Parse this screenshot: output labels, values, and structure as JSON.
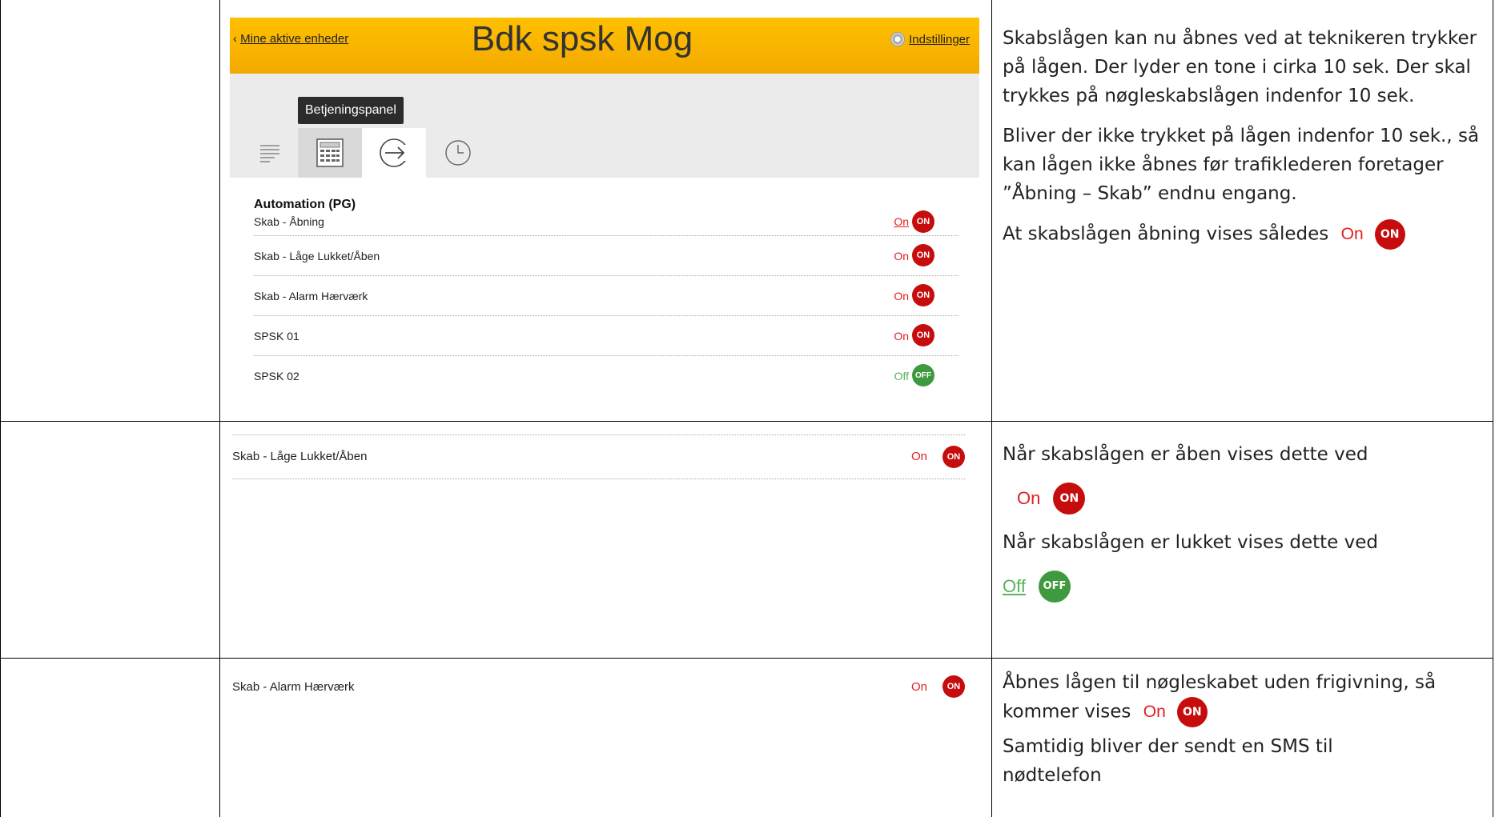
{
  "app": {
    "back_link": "Mine aktive enheder",
    "title": "Bdk spsk Mog",
    "settings_label": "Indstillinger",
    "tooltip": "Betjeningspanel",
    "tabs": [
      {
        "icon": "list-icon",
        "selected": false
      },
      {
        "icon": "keypad-icon",
        "selected": false
      },
      {
        "icon": "arrow-right-circle-icon",
        "selected": true
      },
      {
        "icon": "clock-icon",
        "selected": false
      }
    ],
    "section_title": "Automation (PG)",
    "rows": [
      {
        "label": "Skab - Åbning",
        "state": "On",
        "badge": "ON",
        "status": "on"
      },
      {
        "label": "Skab - Låge Lukket/Åben",
        "state": "On",
        "badge": "ON",
        "status": "on"
      },
      {
        "label": "Skab - Alarm Hærværk",
        "state": "On",
        "badge": "ON",
        "status": "on"
      },
      {
        "label": "SPSK 01",
        "state": "On",
        "badge": "ON",
        "status": "on"
      },
      {
        "label": "SPSK 02",
        "state": "Off",
        "badge": "OFF",
        "status": "off"
      }
    ]
  },
  "row2": {
    "label": "Skab - Låge Lukket/Åben",
    "state": "On",
    "badge": "ON"
  },
  "row3": {
    "label": "Skab - Alarm Hærværk",
    "state": "On",
    "badge": "ON"
  },
  "desc1": {
    "p1": "Skabslågen kan nu åbnes ved at teknikeren trykker på lågen. Der lyder en tone i cirka 10 sek. Der skal trykkes på nøgleskabslågen indenfor 10 sek.",
    "p2": "Bliver der ikke trykket på lågen indenfor 10 sek., så kan lågen ikke åbnes før trafiklederen foretager ”Åbning – Skab” endnu engang.",
    "p3": "At skabslågen åbning vises således",
    "state": "On",
    "badge": "ON"
  },
  "desc2": {
    "p1": "Når skabslågen er åben vises dette ved",
    "on_state": "On",
    "on_badge": "ON",
    "p2": "Når skabslågen er lukket vises dette ved",
    "off_state": "Off",
    "off_badge": "OFF"
  },
  "desc3": {
    "p1": "Åbnes lågen til nøgleskabet uden frigivning, så kommer vises",
    "state": "On",
    "badge": "ON",
    "p2": "Samtidig bliver der sendt en SMS til nødtelefon"
  },
  "colors": {
    "header": "#ffc000",
    "on": "#c60c0c",
    "off": "#3f9a3f"
  }
}
